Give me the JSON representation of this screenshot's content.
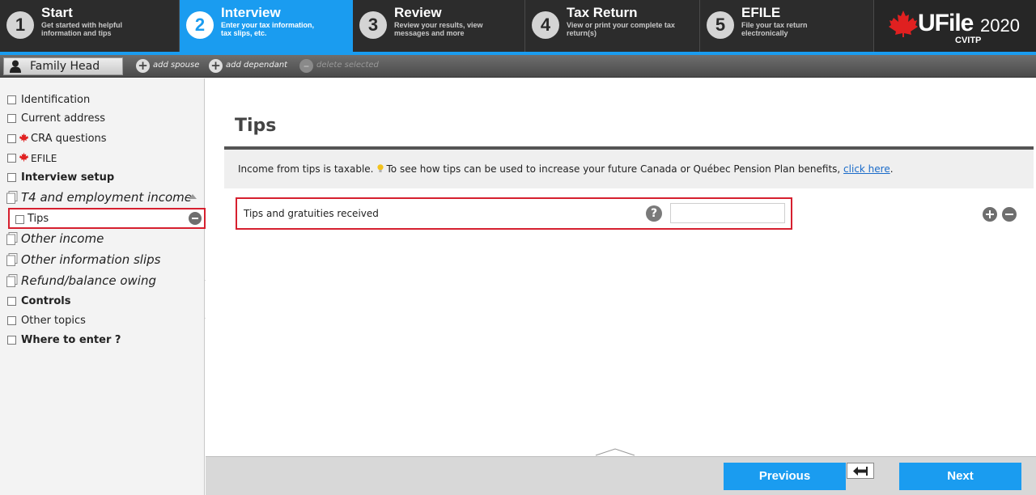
{
  "steps": [
    {
      "number": "1",
      "title": "Start",
      "desc": "Get started with helpful information and tips"
    },
    {
      "number": "2",
      "title": "Interview",
      "desc": "Enter your tax information, tax slips, etc."
    },
    {
      "number": "3",
      "title": "Review",
      "desc": "Review your results, view messages and more"
    },
    {
      "number": "4",
      "title": "Tax Return",
      "desc": "View or print your complete tax return(s)"
    },
    {
      "number": "5",
      "title": "EFILE",
      "desc": "File your tax return electronically"
    }
  ],
  "active_step": "2",
  "logo": {
    "brand": "UFile",
    "year": "2020",
    "edition": "CVITP"
  },
  "family_bar": {
    "family_head": "Family Head",
    "add_spouse": "add spouse",
    "add_dependant": "add dependant",
    "delete_selected": "delete selected"
  },
  "sidebar": {
    "items": [
      {
        "label": "Identification"
      },
      {
        "label": "Current address"
      },
      {
        "label": "CRA questions"
      },
      {
        "label": "EFILE"
      },
      {
        "label": "Interview setup"
      },
      {
        "label": "T4 and employment income"
      },
      {
        "label": "Tips"
      },
      {
        "label": "Other income"
      },
      {
        "label": "Other information slips"
      },
      {
        "label": "Refund/balance owing"
      },
      {
        "label": "Controls"
      },
      {
        "label": "Other topics"
      },
      {
        "label": "Where to enter ?"
      }
    ]
  },
  "main": {
    "title": "Tips",
    "info_text": "Income from tips is taxable.",
    "info_text_2": "To see how tips can be used to increase your future Canada or Québec Pension Plan benefits,",
    "info_link": "click here",
    "info_end": ".",
    "field_label": "Tips and gratuities received",
    "help_glyph": "?",
    "field_value": ""
  },
  "footer": {
    "previous": "Previous",
    "next": "Next"
  },
  "colors": {
    "accent": "#1a9cf0",
    "highlight": "#d6202f",
    "topbar": "#262626"
  }
}
